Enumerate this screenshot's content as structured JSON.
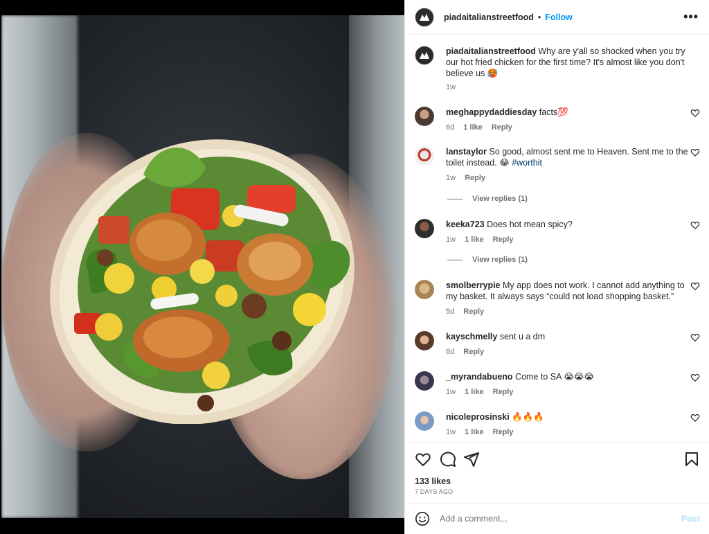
{
  "post": {
    "username": "piadaitalianstreetfood",
    "follow_label": "Follow",
    "caption": {
      "username": "piadaitalianstreetfood",
      "text": "Why are y'all so shocked when you try our hot fried chicken for the first time? It's almost like you don't believe us 🥵",
      "time": "1w"
    },
    "comments": [
      {
        "username": "meghappydaddiesday",
        "text": "facts💯",
        "time": "6d",
        "likes": "1 like",
        "reply": "Reply"
      },
      {
        "username": "lanstaylor",
        "text": "So good, almost sent me to Heaven. Sent me to the toilet instead. 😂 ",
        "hashtag": "#worthit",
        "time": "1w",
        "reply": "Reply",
        "view_replies": "View replies (1)"
      },
      {
        "username": "keeka723",
        "text": "Does hot mean spicy?",
        "time": "1w",
        "likes": "1 like",
        "reply": "Reply",
        "view_replies": "View replies (1)"
      },
      {
        "username": "smolberrypie",
        "text": "My app does not work. I cannot add anything to my basket. It always says “could not load shopping basket.”",
        "time": "5d",
        "reply": "Reply"
      },
      {
        "username": "kayschmelly",
        "text": "sent u a dm",
        "time": "6d",
        "reply": "Reply"
      },
      {
        "username": "_myrandabueno",
        "text": "Come to SA 😭😭😭",
        "time": "1w",
        "likes": "1 like",
        "reply": "Reply"
      },
      {
        "username": "nicoleprosinski",
        "text": "🔥🔥🔥",
        "time": "1w",
        "likes": "1 like",
        "reply": "Reply"
      }
    ],
    "likes": "133 likes",
    "date": "7 DAYS AGO",
    "add_comment_placeholder": "Add a comment...",
    "post_label": "Post"
  },
  "icons": {
    "more": "more-horizontal-icon",
    "like": "heart-icon",
    "comment": "comment-icon",
    "share": "share-icon",
    "save": "bookmark-icon",
    "emoji": "emoji-icon"
  },
  "colors": {
    "accent": "#0095f6",
    "post_disabled": "#b2dffc",
    "hashtag": "#00376b"
  }
}
